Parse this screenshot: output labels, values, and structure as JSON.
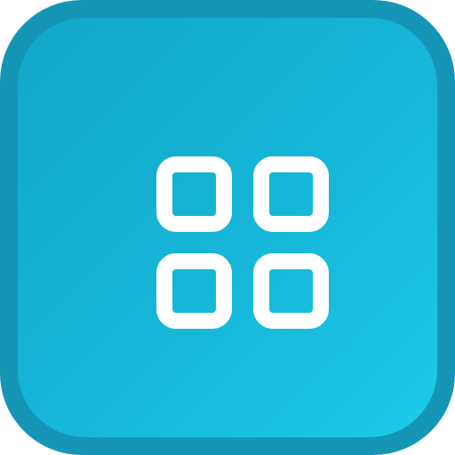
{
  "app_icon": {
    "name": "apps-grid",
    "icon": "grid-icon",
    "colors": {
      "outer_border": "#1596b7",
      "gradient_start": "#12a7c8",
      "gradient_mid": "#16b6d8",
      "gradient_end": "#1dcbe9",
      "glyph": "#ffffff"
    }
  }
}
